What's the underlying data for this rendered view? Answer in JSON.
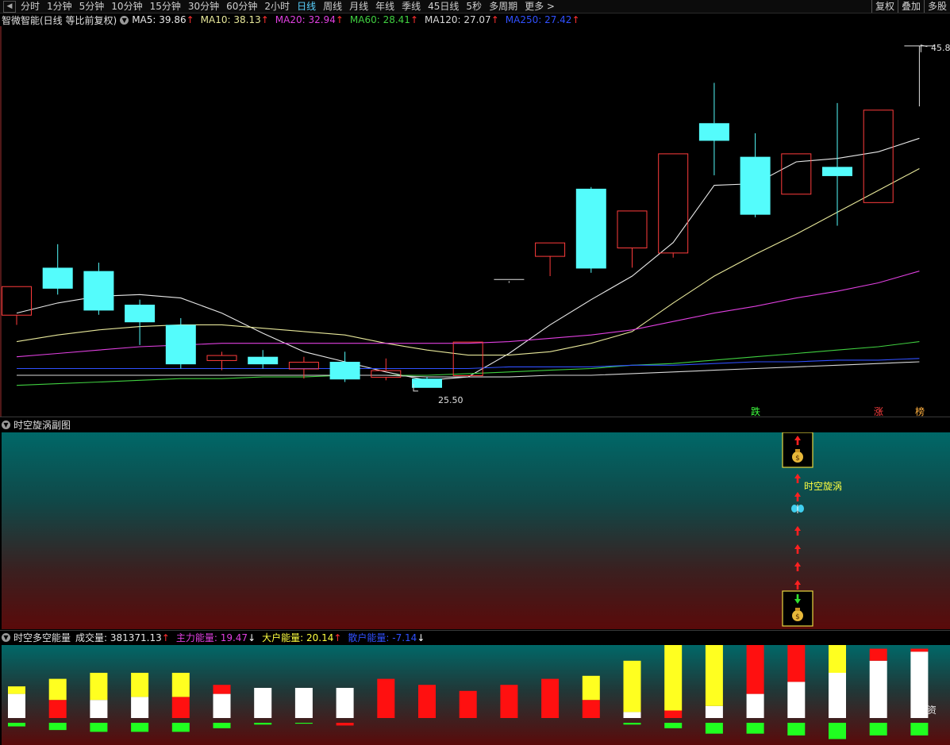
{
  "toolbar": {
    "tabs": [
      {
        "label": "分时",
        "active": false
      },
      {
        "label": "1分钟",
        "active": false
      },
      {
        "label": "5分钟",
        "active": false
      },
      {
        "label": "10分钟",
        "active": false
      },
      {
        "label": "15分钟",
        "active": false
      },
      {
        "label": "30分钟",
        "active": false
      },
      {
        "label": "60分钟",
        "active": false
      },
      {
        "label": "2小时",
        "active": false
      },
      {
        "label": "日线",
        "active": true
      },
      {
        "label": "周线",
        "active": false
      },
      {
        "label": "月线",
        "active": false
      },
      {
        "label": "年线",
        "active": false
      },
      {
        "label": "季线",
        "active": false
      },
      {
        "label": "45日线",
        "active": false
      },
      {
        "label": "5秒",
        "active": false
      },
      {
        "label": "多周期",
        "active": false
      },
      {
        "label": "更多 >",
        "active": false
      }
    ],
    "right_buttons": [
      "复权",
      "叠加",
      "多股"
    ]
  },
  "main_chart": {
    "title": "智微智能(日线 等比前复权)",
    "ma_legend": [
      {
        "name": "MA5",
        "value": "39.86",
        "arrow": "↑",
        "color": "#e8e8e8"
      },
      {
        "name": "MA10",
        "value": "38.13",
        "arrow": "↑",
        "color": "#e8e89a"
      },
      {
        "name": "MA20",
        "value": "32.94",
        "arrow": "↑",
        "color": "#e040e0"
      },
      {
        "name": "MA60",
        "value": "28.41",
        "arrow": "↑",
        "color": "#40d040"
      },
      {
        "name": "MA120",
        "value": "27.07",
        "arrow": "↑",
        "color": "#d8d8d8"
      },
      {
        "name": "MA250",
        "value": "27.42",
        "arrow": "↑",
        "color": "#3050ff"
      }
    ],
    "high_label": "45.8",
    "low_label": "25.50",
    "signal_labels": [
      {
        "text": "跌",
        "color": "#40ff40"
      },
      {
        "text": "涨",
        "color": "#ff4040"
      },
      {
        "text": "榜",
        "color": "#ffb040"
      }
    ]
  },
  "chart_data": {
    "type": "candlestick",
    "y_range": [
      24.5,
      46.5
    ],
    "candles": [
      {
        "o": 31.5,
        "h": 31.5,
        "l": 29.2,
        "c": 29.8,
        "dir": "up"
      },
      {
        "o": 32.6,
        "h": 34.0,
        "l": 31.0,
        "c": 31.4,
        "dir": "down"
      },
      {
        "o": 32.4,
        "h": 32.9,
        "l": 29.8,
        "c": 30.1,
        "dir": "down"
      },
      {
        "o": 30.4,
        "h": 30.7,
        "l": 28.0,
        "c": 29.4,
        "dir": "down"
      },
      {
        "o": 29.2,
        "h": 29.6,
        "l": 26.6,
        "c": 26.9,
        "dir": "down"
      },
      {
        "o": 27.1,
        "h": 27.6,
        "l": 26.5,
        "c": 27.4,
        "dir": "up"
      },
      {
        "o": 27.3,
        "h": 27.7,
        "l": 26.6,
        "c": 26.9,
        "dir": "down"
      },
      {
        "o": 26.6,
        "h": 27.3,
        "l": 26.0,
        "c": 27.0,
        "dir": "up"
      },
      {
        "o": 27.0,
        "h": 27.6,
        "l": 25.8,
        "c": 26.0,
        "dir": "down"
      },
      {
        "o": 26.1,
        "h": 27.2,
        "l": 25.9,
        "c": 26.5,
        "dir": "up"
      },
      {
        "o": 26.0,
        "h": 26.1,
        "l": 25.5,
        "c": 25.5,
        "dir": "down"
      },
      {
        "o": 26.2,
        "h": 28.2,
        "l": 26.2,
        "c": 28.2,
        "dir": "up"
      },
      {
        "o": 31.9,
        "h": 31.9,
        "l": 31.7,
        "c": 31.8,
        "dir": "flat"
      },
      {
        "o": 33.3,
        "h": 34.1,
        "l": 32.1,
        "c": 34.1,
        "dir": "up"
      },
      {
        "o": 37.3,
        "h": 37.4,
        "l": 32.3,
        "c": 32.6,
        "dir": "down"
      },
      {
        "o": 33.8,
        "h": 36.0,
        "l": 32.6,
        "c": 36.0,
        "dir": "up"
      },
      {
        "o": 33.5,
        "h": 39.4,
        "l": 33.2,
        "c": 39.4,
        "dir": "up"
      },
      {
        "o": 41.2,
        "h": 43.6,
        "l": 38.1,
        "c": 40.2,
        "dir": "down"
      },
      {
        "o": 39.2,
        "h": 40.6,
        "l": 35.6,
        "c": 35.8,
        "dir": "down"
      },
      {
        "o": 37.0,
        "h": 39.4,
        "l": 37.0,
        "c": 39.4,
        "dir": "up"
      },
      {
        "o": 38.6,
        "h": 42.4,
        "l": 35.1,
        "c": 38.1,
        "dir": "down"
      },
      {
        "o": 36.5,
        "h": 42.0,
        "l": 36.5,
        "c": 42.0,
        "dir": "up"
      },
      {
        "o": 45.8,
        "h": 45.8,
        "l": 42.2,
        "c": 45.8,
        "dir": "flat-white"
      }
    ],
    "ma_series": [
      {
        "name": "MA5",
        "color": "#e8e8e8",
        "values": [
          29.9,
          30.5,
          30.9,
          31.0,
          30.8,
          29.9,
          28.7,
          27.6,
          27.0,
          26.4,
          25.9,
          26.1,
          27.5,
          29.2,
          30.7,
          32.1,
          34.1,
          37.5,
          37.6,
          38.9,
          39.1,
          39.5,
          40.3
        ]
      },
      {
        "name": "MA10",
        "color": "#e8e89a",
        "values": [
          28.2,
          28.6,
          28.9,
          29.1,
          29.2,
          29.2,
          29.0,
          28.8,
          28.6,
          28.1,
          27.7,
          27.4,
          27.4,
          27.6,
          28.1,
          28.8,
          30.5,
          32.1,
          33.4,
          34.6,
          35.9,
          37.2,
          38.5
        ]
      },
      {
        "name": "MA20",
        "color": "#e040e0",
        "values": [
          27.3,
          27.5,
          27.7,
          27.9,
          28.0,
          28.1,
          28.1,
          28.1,
          28.1,
          28.1,
          28.1,
          28.1,
          28.2,
          28.4,
          28.6,
          28.9,
          29.4,
          29.9,
          30.3,
          30.8,
          31.2,
          31.7,
          32.4
        ]
      },
      {
        "name": "MA60",
        "color": "#40d040",
        "values": [
          25.6,
          25.7,
          25.8,
          25.9,
          26.0,
          26.0,
          26.1,
          26.1,
          26.2,
          26.2,
          26.2,
          26.3,
          26.4,
          26.5,
          26.6,
          26.8,
          26.9,
          27.1,
          27.3,
          27.5,
          27.7,
          27.9,
          28.2
        ]
      },
      {
        "name": "MA120",
        "color": "#d8d8d8",
        "values": [
          26.2,
          26.2,
          26.2,
          26.2,
          26.2,
          26.2,
          26.2,
          26.2,
          26.2,
          26.2,
          26.1,
          26.1,
          26.1,
          26.2,
          26.2,
          26.3,
          26.4,
          26.5,
          26.6,
          26.7,
          26.8,
          26.9,
          27.0
        ]
      },
      {
        "name": "MA250",
        "color": "#3050ff",
        "values": [
          26.6,
          26.6,
          26.6,
          26.6,
          26.6,
          26.6,
          26.6,
          26.6,
          26.6,
          26.6,
          26.6,
          26.6,
          26.7,
          26.7,
          26.7,
          26.8,
          26.8,
          26.9,
          27.0,
          27.0,
          27.1,
          27.1,
          27.2
        ]
      }
    ]
  },
  "sub_chart1": {
    "title": "时空旋涡副图",
    "vortex_label": "时空旋涡",
    "money_icon": "money-bag-icon",
    "butterfly_icon": "butterfly-icon"
  },
  "sub_chart2": {
    "title": "时空多空能量",
    "legend": [
      {
        "name": "成交量",
        "value": "381371.13",
        "arrow": "↑",
        "color": "#e8e8e8",
        "arrow_color": "#ff3030"
      },
      {
        "name": "主力能量",
        "value": "19.47",
        "arrow": "↓",
        "color": "#e040e0",
        "arrow_color": "#ffffff"
      },
      {
        "name": "大户能量",
        "value": "20.14",
        "arrow": "↑",
        "color": "#ffff40",
        "arrow_color": "#ff3030"
      },
      {
        "name": "散户能量",
        "value": "-7.14",
        "arrow": "↓",
        "color": "#3050ff",
        "arrow_color": "#ffffff"
      }
    ],
    "corner_label": "资",
    "energy_bars": [
      {
        "white": 0.8,
        "yellow": 0.25,
        "red": 0,
        "green": 0.2
      },
      {
        "white": 0,
        "yellow": 0.7,
        "red": 0.6,
        "green": 0.4
      },
      {
        "white": 0.6,
        "yellow": 0.9,
        "red": 0,
        "green": 0.5
      },
      {
        "white": 0.7,
        "yellow": 0.8,
        "red": 0,
        "green": 0.5
      },
      {
        "white": 0,
        "yellow": 0.8,
        "red": 0.7,
        "green": 0.5
      },
      {
        "white": 0.8,
        "yellow": 0,
        "red": 0.3,
        "green": 0.3
      },
      {
        "white": 1.0,
        "yellow": 0,
        "red": 0,
        "green": 0.1
      },
      {
        "white": 1.0,
        "yellow": 0,
        "red": 0,
        "green": 0.05
      },
      {
        "white": 1.0,
        "yellow": 0,
        "red": 0,
        "green": -0.15
      },
      {
        "white": 0,
        "yellow": 0,
        "red": 1.3,
        "green": 0
      },
      {
        "white": 0,
        "yellow": 0,
        "red": 1.1,
        "green": 0
      },
      {
        "white": 0,
        "yellow": 0,
        "red": 0.9,
        "green": 0
      },
      {
        "white": 0,
        "yellow": 0,
        "red": 1.1,
        "green": 0
      },
      {
        "white": 0,
        "yellow": 0,
        "red": 1.3,
        "green": 0
      },
      {
        "white": 0,
        "yellow": 0.8,
        "red": 0.6,
        "green": 0
      },
      {
        "white": 0.2,
        "yellow": 1.7,
        "red": 0,
        "green": 0.1
      },
      {
        "white": 0,
        "yellow": 2.4,
        "red": 0.25,
        "green": 0.3
      },
      {
        "white": 0.4,
        "yellow": 2.7,
        "red": 0,
        "green": 0.6
      },
      {
        "white": 0.8,
        "yellow": 0,
        "red": 2.1,
        "green": 0.6
      },
      {
        "white": 1.2,
        "yellow": 0,
        "red": 1.6,
        "green": 0.7
      },
      {
        "white": 1.5,
        "yellow": 1.5,
        "red": 0,
        "green": 0.9
      },
      {
        "white": 1.9,
        "yellow": 0,
        "red": 0.4,
        "green": 0.7
      },
      {
        "white": 2.2,
        "yellow": 0,
        "red": 0.1,
        "green": 0.7
      }
    ]
  }
}
